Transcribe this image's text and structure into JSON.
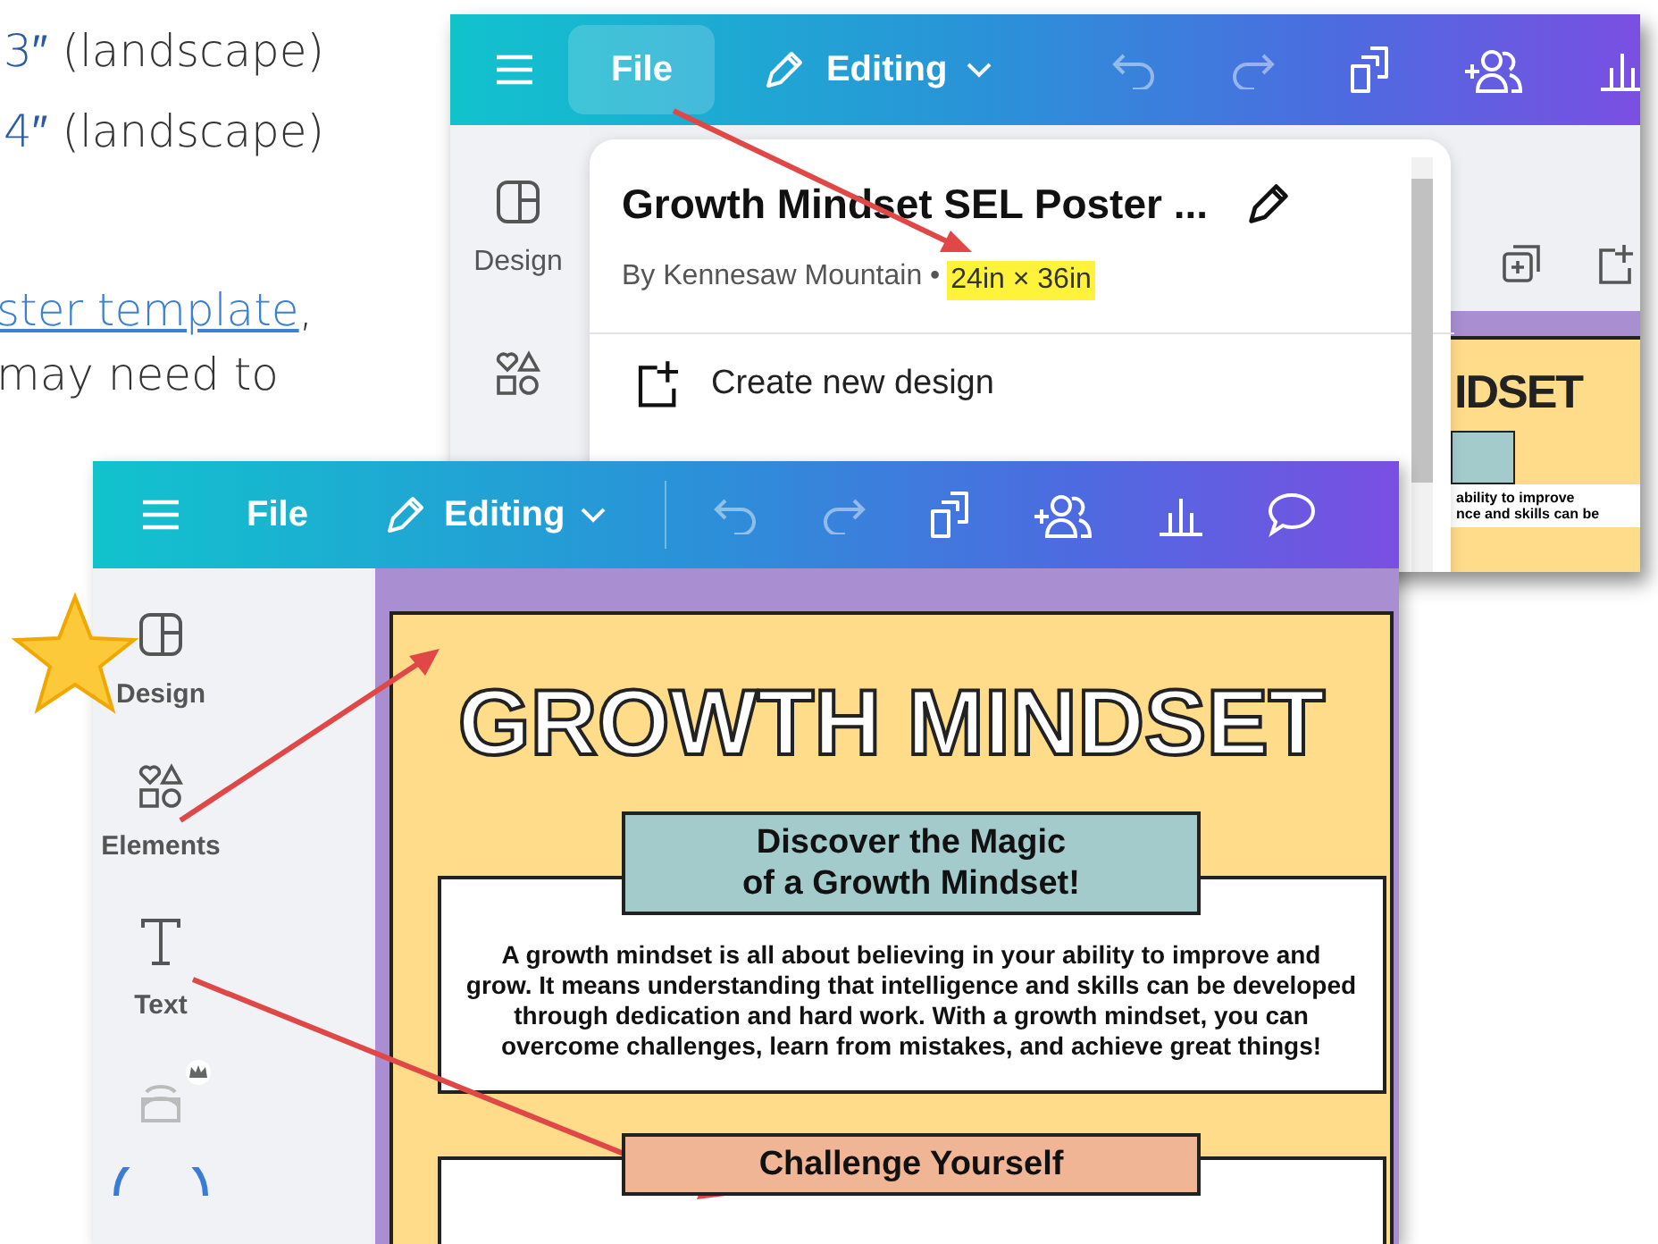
{
  "document_text": {
    "list_items": [
      {
        "accent": "3″",
        "rest": " (landscape)"
      },
      {
        "accent": "4″",
        "rest": " (landscape)"
      }
    ],
    "paragraph_lines": [
      {
        "link": "ster template",
        "rest": ","
      },
      {
        "text": "may need to"
      }
    ]
  },
  "back_screenshot": {
    "toolbar": {
      "file": {
        "label": "File",
        "selected": true
      },
      "mode": "Editing",
      "history": [
        {
          "kind": "undo",
          "disabled": true
        },
        {
          "kind": "redo",
          "disabled": true
        }
      ]
    },
    "sidebar": [
      {
        "kind": "design",
        "label": "Design"
      },
      {
        "kind": "elements"
      }
    ],
    "file_menu": {
      "title": "Growth Mindset SEL Poster ...",
      "author": "By Kennesaw Mountain •",
      "size": {
        "text": "24in × 36in",
        "highlighted": true
      },
      "items": [
        "Create new design"
      ]
    },
    "poster_preview": {
      "title_fragment": "IDSET",
      "text_lines": [
        "ability to improve",
        "nce and skills can be"
      ]
    }
  },
  "front_screenshot": {
    "toolbar": {
      "file": {
        "label": "File",
        "selected": false
      },
      "mode": "Editing",
      "history": [
        {
          "kind": "undo",
          "disabled": true
        },
        {
          "kind": "redo",
          "disabled": true
        }
      ]
    },
    "sidebar": [
      {
        "kind": "design",
        "label": "Design"
      },
      {
        "kind": "elements",
        "label": "Elements"
      },
      {
        "kind": "text",
        "label": "Text"
      },
      {
        "kind": "brand",
        "premium": true
      }
    ],
    "poster": {
      "title": "GROWTH MINDSET",
      "sections": [
        {
          "heading": "Discover the Magic\nof a Growth Mindset!",
          "color": "#a4cbcc",
          "body": "A growth mindset is all about believing in your ability to improve and grow. It means understanding that intelligence and skills can be developed through dedication and hard work. With a growth mindset, you can overcome challenges, learn from mistakes, and achieve great things!"
        },
        {
          "heading": "Challenge Yourself",
          "color": "#f0b594"
        }
      ]
    }
  }
}
